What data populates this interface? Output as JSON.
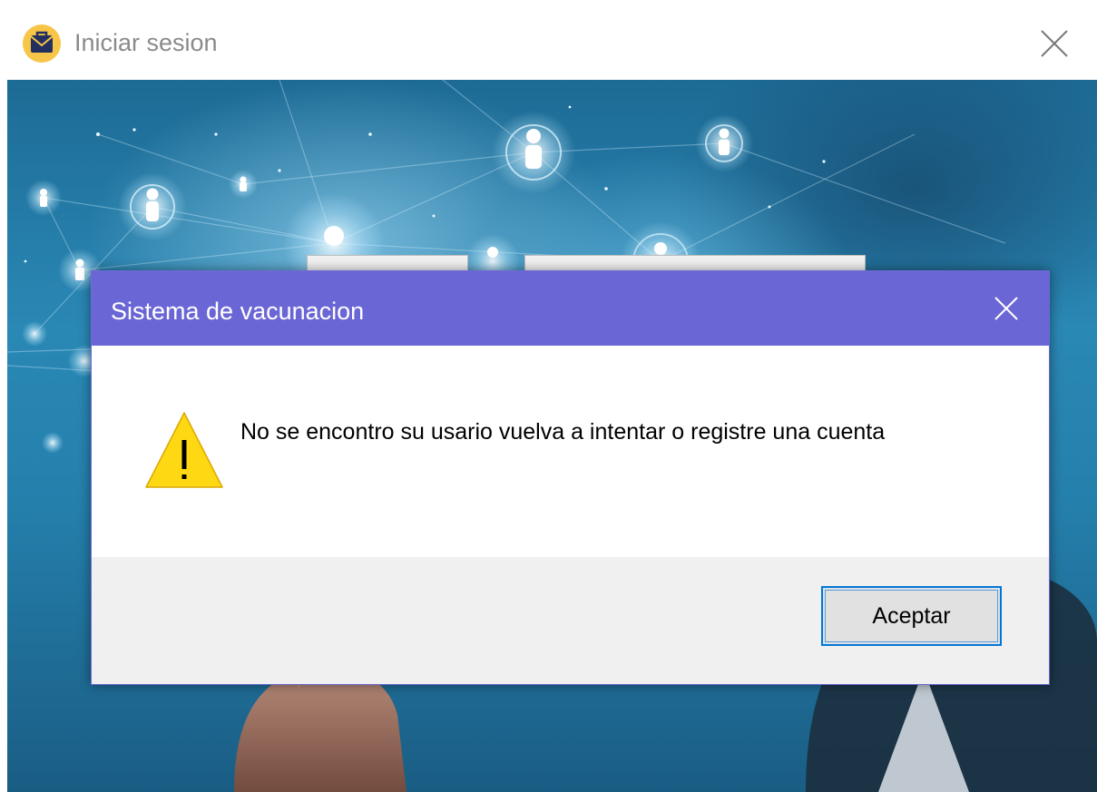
{
  "window": {
    "title": "Iniciar sesion",
    "icon": "briefcase-icon",
    "close_icon": "close-icon"
  },
  "dialog": {
    "title": "Sistema de vacunacion",
    "message": "No se encontro su usario vuelva a intentar o registre una cuenta",
    "icon": "warning-icon",
    "close_icon": "close-icon",
    "ok_label": "Aceptar"
  },
  "colors": {
    "dialog_titlebar": "#6b66d5",
    "button_focus_border": "#0078d7",
    "warning_yellow": "#ffd814",
    "app_icon_yellow": "#f7c548",
    "app_icon_navy": "#23305f"
  }
}
